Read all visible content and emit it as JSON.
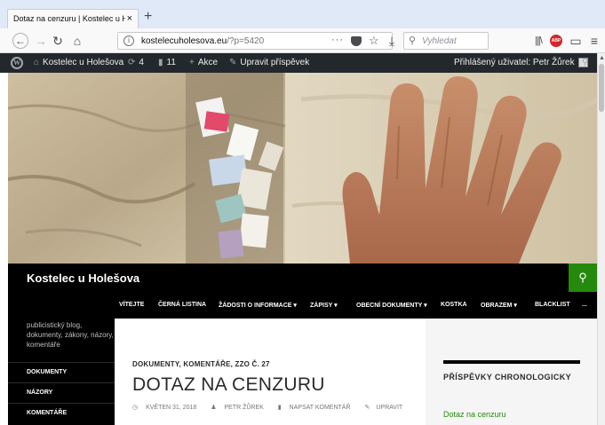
{
  "browser": {
    "tab_title": "Dotaz na cenzuru | Kostelec u Holešova",
    "tab_close": "×",
    "newtab": "+",
    "url_host": "kostelecuholesova.eu",
    "url_path": "/?p=5420",
    "more": "···",
    "search_placeholder": "Vyhledat",
    "abp": "ABP"
  },
  "adminbar": {
    "site_name": "Kostelec u Holešova",
    "updates_count": "4",
    "comments_count": "11",
    "new_label": "Akce",
    "edit_label": "Upravit příspěvek",
    "user_label": "Přihlášený uživatel: Petr Žůrek"
  },
  "site": {
    "title": "Kostelec u Holešova",
    "description": "publicistický blog, dokumenty, zákony, názory, komentáře"
  },
  "main_menu": [
    {
      "label": "VÍTEJTE"
    },
    {
      "label": "ČERNÁ LISTINA"
    },
    {
      "label": "ŽÁDOSTI O INFORMACE ▾"
    },
    {
      "label": "ZÁPISY ▾"
    },
    {
      "label": "OBECNÍ DOKUMENTY ▾"
    },
    {
      "label": "KOSTKA"
    },
    {
      "label": "OBRAZEM ▾"
    },
    {
      "label": "BLACKLIST"
    },
    {
      "label": "..."
    }
  ],
  "sidebar_menu": [
    {
      "label": "DOKUMENTY"
    },
    {
      "label": "NÁZORY"
    },
    {
      "label": "KOMENTÁŘE"
    }
  ],
  "post": {
    "categories": "DOKUMENTY, KOMENTÁŘE, ZZO Č. 27",
    "title": "DOTAZ NA CENZURU",
    "date": "KVĚTEN 31, 2018",
    "author": "PETR ŽŮREK",
    "comment_link": "NAPSAT KOMENTÁŘ",
    "edit_link": "UPRAVIT"
  },
  "widget": {
    "title": "PŘÍSPĚVKY CHRONOLOGICKY",
    "first_link": "Dotaz na cenzuru"
  },
  "colors": {
    "accent_green": "#24890d",
    "admin_bar": "#23282d",
    "header_black": "#000000"
  }
}
